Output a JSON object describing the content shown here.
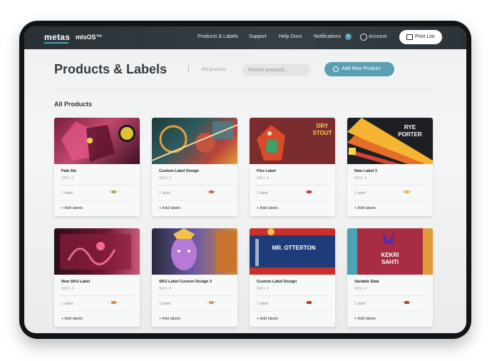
{
  "topbar": {
    "logo": "metas",
    "product": "mlsOS™",
    "nav": [
      "Products & Labels",
      "Support",
      "Help Docs",
      "Notifications",
      "Account"
    ],
    "notifications_badge": "1",
    "print_label": "Print List"
  },
  "page": {
    "title": "Products & Labels",
    "count": "459 products",
    "search_placeholder": "Search products...",
    "add_label": "Add New Product",
    "section": "All Products"
  },
  "products": [
    {
      "name": "Pale Ale",
      "sku": "SKU: #",
      "labels": "1 label",
      "add": "+ Add labels"
    },
    {
      "name": "Custom Label Design",
      "sku": "SKU: #",
      "labels": "1 label",
      "add": "+ Add labels"
    },
    {
      "name": "Flex Label",
      "sku": "SKU: #",
      "labels": "1 label",
      "add": "+ Add labels",
      "art_text": "DRY STOUT"
    },
    {
      "name": "New Label 3",
      "sku": "SKU: #",
      "labels": "1 label",
      "add": "+ Add labels",
      "art_text": "RYE PORTER"
    },
    {
      "name": "New SKU Label",
      "sku": "SKU: #",
      "labels": "1 label",
      "add": "+ Add labels"
    },
    {
      "name": "SKU Label Custom Design 3",
      "sku": "SKU: #",
      "labels": "1 label",
      "add": "+ Add labels"
    },
    {
      "name": "Custom Label Design",
      "sku": "SKU: #",
      "labels": "1 label",
      "add": "+ Add labels",
      "art_text": "MR. OTTERTON"
    },
    {
      "name": "Variable Data",
      "sku": "SKU: #",
      "labels": "1 label",
      "add": "+ Add labels",
      "art_text": "KEKRI SAHTI"
    }
  ],
  "colors": {
    "accent": "#5b9fb3",
    "topbar": "#30383d"
  }
}
